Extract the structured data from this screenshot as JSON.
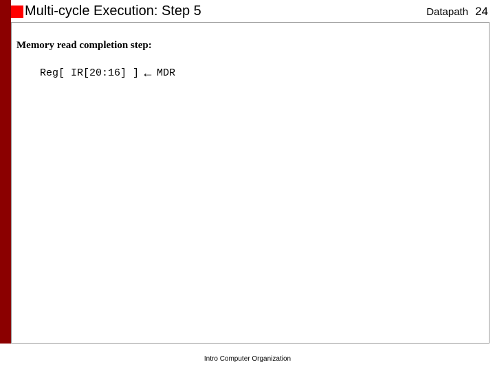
{
  "slide": {
    "title": "Multi-cycle Execution: Step 5",
    "category": "Datapath",
    "number": "24"
  },
  "content": {
    "sub_heading": "Memory read completion step:",
    "code_left": "Reg[ IR[20:16] ]",
    "arrow": "←",
    "code_right": "MDR"
  },
  "footer": {
    "text": "Intro Computer Organization"
  }
}
